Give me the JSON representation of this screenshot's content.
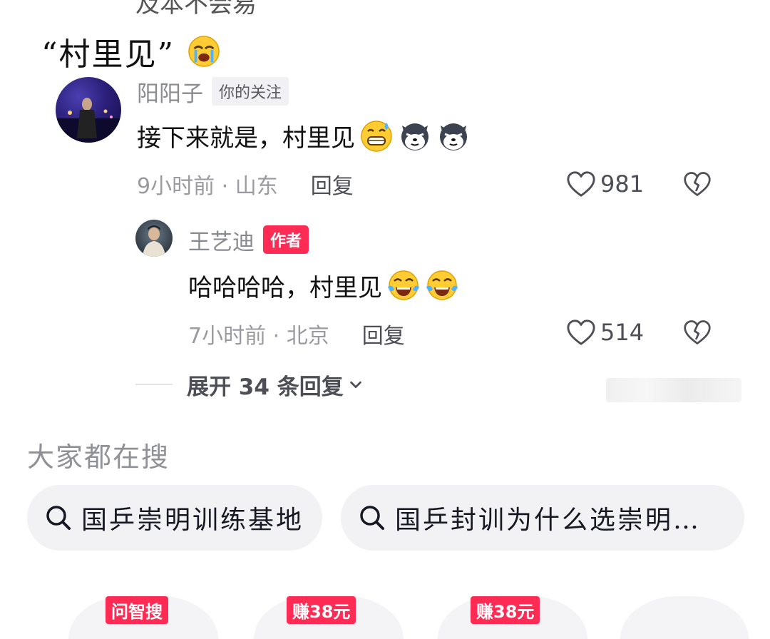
{
  "top_cut_text": "及本不会易",
  "caption": "“村里见”",
  "comments": [
    {
      "username": "阳阳子",
      "tag": "你的关注",
      "text": "接下来就是，村里见",
      "time_location": "9小时前 · 山东",
      "reply_label": "回复",
      "likes": "981",
      "emojis": [
        "grin-sweat-emoji",
        "husky-dog-emoji",
        "husky-dog-emoji"
      ]
    },
    {
      "username": "王艺迪",
      "tag": "作者",
      "text": "哈哈哈哈，村里见",
      "time_location": "7小时前 · 北京",
      "reply_label": "回复",
      "likes": "514",
      "emojis": [
        "tears-of-joy-emoji",
        "tears-of-joy-emoji"
      ]
    }
  ],
  "expand_replies": "展开 34 条回复",
  "search_section": {
    "heading": "大家都在搜",
    "suggestions": [
      "国乒崇明训练基地",
      "国乒封训为什么选崇明…"
    ]
  },
  "cards": [
    {
      "badge": "问智搜"
    },
    {
      "badge": "赚38元"
    },
    {
      "badge": "赚38元"
    },
    {
      "badge": ""
    }
  ],
  "colors": {
    "accent": "#fe2c55",
    "muted_text": "#8a8b91",
    "pill_bg": "#f2f2f4"
  }
}
